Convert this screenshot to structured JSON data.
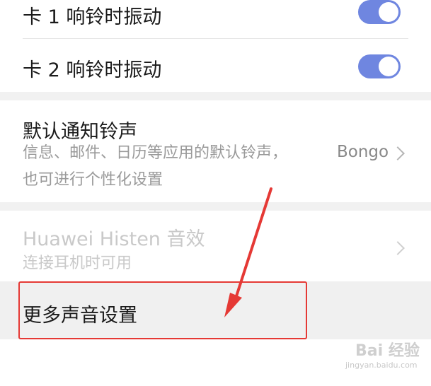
{
  "settings": {
    "card1_vibrate": {
      "label": "卡 1 响铃时振动",
      "enabled": true
    },
    "card2_vibrate": {
      "label": "卡 2 响铃时振动",
      "enabled": true
    },
    "default_notification_ringtone": {
      "label": "默认通知铃声",
      "description_line1": "信息、邮件、日历等应用的默认铃声，",
      "description_line2": "也可进行个性化设置",
      "value": "Bongo"
    },
    "histen": {
      "label": "Huawei Histen 音效",
      "description": "连接耳机时可用",
      "disabled": true
    },
    "more_sound_settings": {
      "label": "更多声音设置"
    }
  },
  "annotation": {
    "color": "#e53935"
  },
  "colors": {
    "toggle_on": "#6f86e0"
  },
  "watermark": {
    "text": "Bai 经验",
    "sub": "jingyan.baidu.com"
  }
}
